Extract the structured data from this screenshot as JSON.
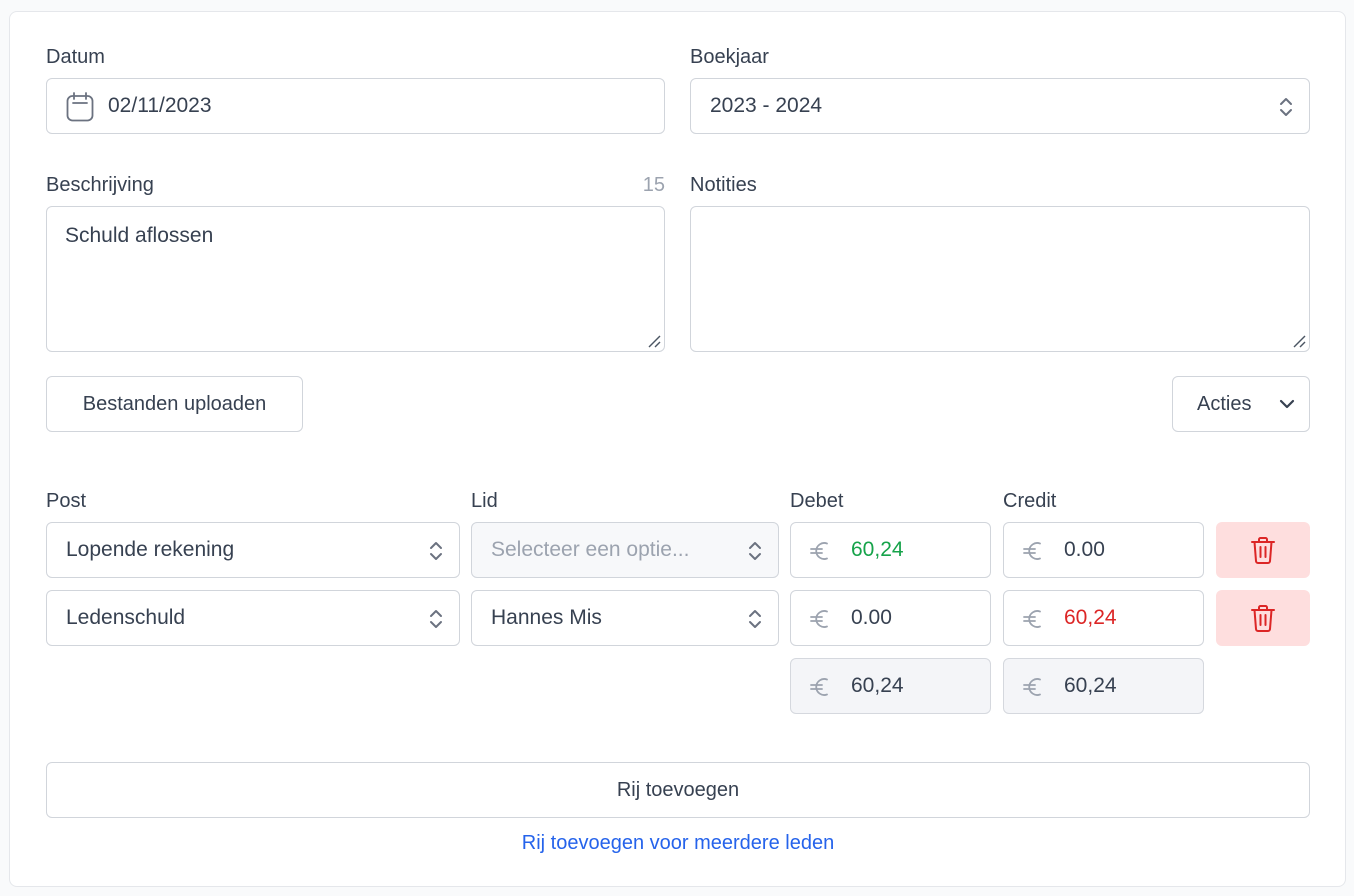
{
  "form": {
    "datum": {
      "label": "Datum",
      "value": "02/11/2023"
    },
    "boekjaar": {
      "label": "Boekjaar",
      "value": "2023 - 2024"
    },
    "beschrijving": {
      "label": "Beschrijving",
      "counter": "15",
      "value": "Schuld aflossen"
    },
    "notities": {
      "label": "Notities",
      "value": ""
    },
    "upload_button": "Bestanden uploaden",
    "acties_button": "Acties"
  },
  "lines": {
    "headers": {
      "post": "Post",
      "lid": "Lid",
      "debet": "Debet",
      "credit": "Credit"
    },
    "rows": [
      {
        "post": "Lopende rekening",
        "lid": "",
        "lid_placeholder": "Selecteer een optie...",
        "debet": "60,24",
        "credit": "0.00"
      },
      {
        "post": "Ledenschuld",
        "lid": "Hannes Mis",
        "lid_placeholder": "",
        "debet": "0.00",
        "credit": "60,24"
      }
    ],
    "totals": {
      "debet": "60,24",
      "credit": "60,24"
    },
    "currency_symbol": "€"
  },
  "actions": {
    "add_row": "Rij toevoegen",
    "add_row_multiple": "Rij toevoegen voor meerdere leden"
  },
  "colors": {
    "debet_positive": "#16a34a",
    "credit_positive": "#dc2626",
    "delete_bg": "#fedede",
    "delete_icon": "#dc2626",
    "link": "#2563eb"
  },
  "icons": {
    "date": "calendar-icon",
    "select": "chevron-up-down-icon",
    "dropdown": "chevron-down-icon",
    "delete": "trash-icon",
    "currency": "euro-icon",
    "resize": "resize-handle-icon"
  }
}
